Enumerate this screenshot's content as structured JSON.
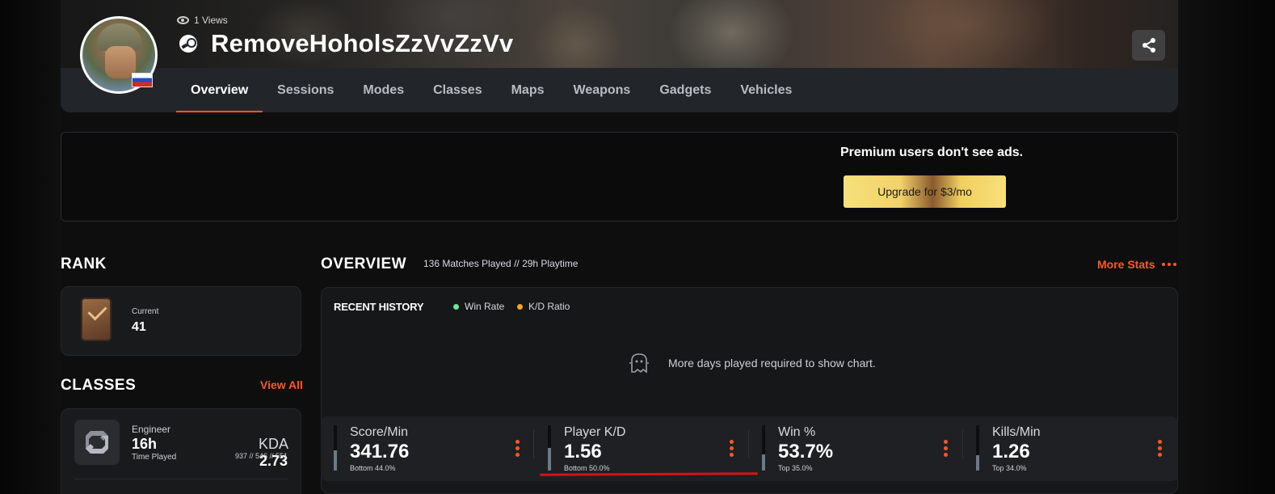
{
  "profile": {
    "views": "1 Views",
    "username": "RemoveHoholsZzVvZzVv",
    "country_flag": "russia",
    "platform_icon": "steam-icon"
  },
  "tabs": [
    {
      "label": "Overview",
      "active": true
    },
    {
      "label": "Sessions",
      "active": false
    },
    {
      "label": "Modes",
      "active": false
    },
    {
      "label": "Classes",
      "active": false
    },
    {
      "label": "Maps",
      "active": false
    },
    {
      "label": "Weapons",
      "active": false
    },
    {
      "label": "Gadgets",
      "active": false
    },
    {
      "label": "Vehicles",
      "active": false
    }
  ],
  "ad": {
    "message": "Premium users don't see ads.",
    "upgrade_label": "Upgrade for $3/mo"
  },
  "rank": {
    "title": "RANK",
    "current_label": "Current",
    "current_value": "41"
  },
  "classes": {
    "title": "CLASSES",
    "view_all": "View All",
    "items": [
      {
        "name": "Engineer",
        "time": "16h",
        "time_label": "Time Played",
        "kda_label": "KDA",
        "kda_value": "2.73",
        "kda_detail": "937 // 546 // 551"
      }
    ]
  },
  "overview": {
    "title": "OVERVIEW",
    "subtitle": "136 Matches Played // 29h Playtime",
    "more_stats": "More Stats",
    "recent_history": "RECENT HISTORY",
    "legend": [
      {
        "label": "Win Rate",
        "color": "#6ee69a"
      },
      {
        "label": "K/D Ratio",
        "color": "#f5a623"
      }
    ],
    "empty_message": "More days played required to show chart."
  },
  "stats": [
    {
      "label": "Score/Min",
      "value": "341.76",
      "sub": "Bottom 44.0%",
      "fill": 0.44
    },
    {
      "label": "Player K/D",
      "value": "1.56",
      "sub": "Bottom 50.0%",
      "fill": 0.5
    },
    {
      "label": "Win %",
      "value": "53.7%",
      "sub": "Top 35.0%",
      "fill": 0.35
    },
    {
      "label": "Kills/Min",
      "value": "1.26",
      "sub": "Top 34.0%",
      "fill": 0.34
    }
  ],
  "colors": {
    "accent": "#ff5722",
    "background": "#0e0e0f",
    "annotation": "#d41515"
  }
}
